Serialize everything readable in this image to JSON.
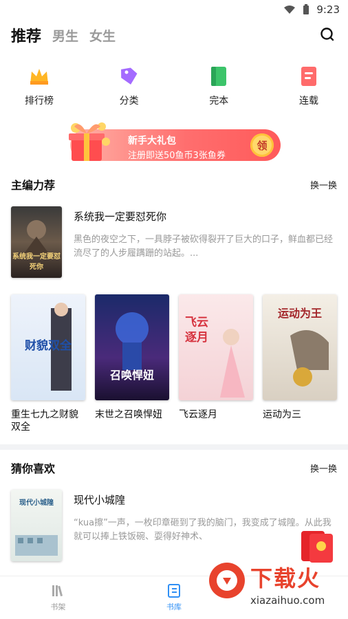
{
  "status": {
    "time": "9:23"
  },
  "tabs": [
    {
      "label": "推荐",
      "active": true
    },
    {
      "label": "男生",
      "active": false
    },
    {
      "label": "女生",
      "active": false
    }
  ],
  "categories": [
    {
      "label": "排行榜",
      "icon": "crown-icon",
      "color": "#ffb625"
    },
    {
      "label": "分类",
      "icon": "tag-icon",
      "color": "#a46bff"
    },
    {
      "label": "完本",
      "icon": "book-icon",
      "color": "#3cc46a"
    },
    {
      "label": "连载",
      "icon": "document-icon",
      "color": "#ff6b6b"
    }
  ],
  "banner": {
    "title": "新手大礼包",
    "subtitle": "注册即送50鱼币3张鱼券",
    "claim": "领"
  },
  "editors_pick": {
    "title": "主编力荐",
    "refresh": "换一换",
    "featured": {
      "book_title": "系统我一定要怼死你",
      "description": "黑色的夜空之下，一具脖子被砍得裂开了巨大的口子，鲜血都已经流尽了的人步履蹒跚的站起。...",
      "cover_text": "系统我一定要怼死你"
    },
    "books": [
      {
        "title": "重生七九之财貌双全",
        "cover_text": "财貌双全"
      },
      {
        "title": "末世之召唤悍妞",
        "cover_text": "召唤悍妞"
      },
      {
        "title": "飞云逐月",
        "cover_text": "飞云逐月"
      },
      {
        "title": "运动为三",
        "cover_text": "运动为王"
      }
    ]
  },
  "guess": {
    "title": "猜你喜欢",
    "refresh": "换一换",
    "featured": {
      "book_title": "现代小城隍",
      "description": "“kua擦”一声，一枚印章砸到了我的脑门，我变成了城隍。从此我就可以捧上铁饭碗、耍得好神术、",
      "cover_text": "现代小城隍"
    }
  },
  "bottom_nav": [
    {
      "label": "书架",
      "active": false
    },
    {
      "label": "书库",
      "active": true
    }
  ],
  "watermark": {
    "text": "下载火",
    "domain": "xiazaihuo.com"
  }
}
